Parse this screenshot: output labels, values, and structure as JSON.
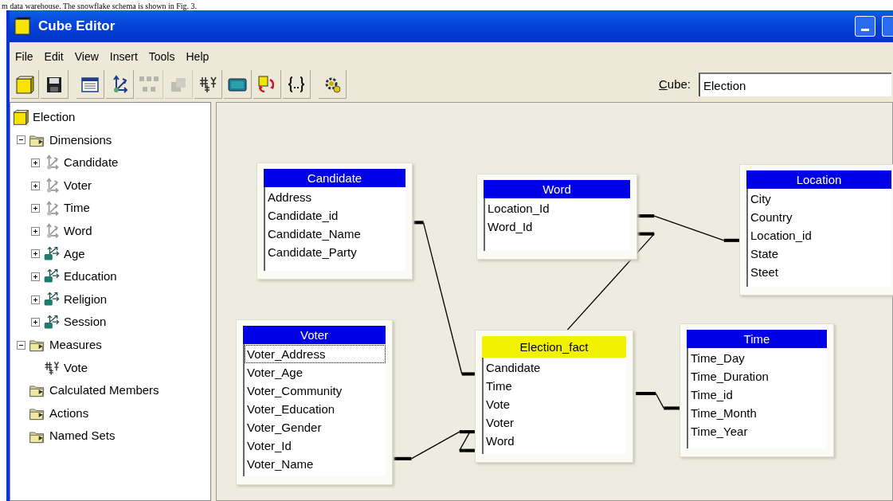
{
  "caption": "m data warehouse. The snowflake schema is shown in Fig. 3.",
  "window": {
    "title": "Cube Editor"
  },
  "menu": [
    "File",
    "Edit",
    "View",
    "Insert",
    "Tools",
    "Help"
  ],
  "toolbar_groups": [
    [
      {
        "kind": "cube",
        "disabled": false
      },
      {
        "kind": "save",
        "disabled": false
      }
    ],
    [
      {
        "kind": "table",
        "disabled": false
      },
      {
        "kind": "dimension",
        "disabled": false
      },
      {
        "kind": "dots",
        "disabled": true
      },
      {
        "kind": "block",
        "disabled": true
      },
      {
        "kind": "measure",
        "disabled": false
      },
      {
        "kind": "screen",
        "disabled": false
      },
      {
        "kind": "process",
        "disabled": false
      },
      {
        "kind": "braces",
        "disabled": false
      }
    ],
    [
      {
        "kind": "gear",
        "disabled": false
      }
    ]
  ],
  "cube_selector": {
    "label": "Cube:",
    "value": "Election"
  },
  "tree": [
    {
      "label": "Election",
      "kind": "cube",
      "children": [
        {
          "label": "Dimensions",
          "kind": "folder",
          "expanded": true,
          "children": [
            {
              "label": "Candidate",
              "kind": "shared_dimension",
              "expanded": false
            },
            {
              "label": "Voter",
              "kind": "shared_dimension",
              "expanded": false
            },
            {
              "label": "Time",
              "kind": "shared_dimension",
              "expanded": false
            },
            {
              "label": "Word",
              "kind": "shared_dimension",
              "expanded": false
            },
            {
              "label": "Age",
              "kind": "private_dimension",
              "expanded": false
            },
            {
              "label": "Education",
              "kind": "private_dimension",
              "expanded": false
            },
            {
              "label": "Religion",
              "kind": "private_dimension",
              "expanded": false
            },
            {
              "label": "Session",
              "kind": "private_dimension",
              "expanded": false
            }
          ]
        },
        {
          "label": "Measures",
          "kind": "folder",
          "expanded": true,
          "children": [
            {
              "label": "Vote",
              "kind": "measure"
            }
          ]
        },
        {
          "label": "Calculated Members",
          "kind": "folder"
        },
        {
          "label": "Actions",
          "kind": "folder"
        },
        {
          "label": "Named Sets",
          "kind": "folder"
        }
      ]
    }
  ],
  "tables": [
    {
      "name": "Candidate",
      "kind": "dimension",
      "fields": [
        {
          "label": "Address",
          "selected": false
        },
        {
          "label": "Candidate_id",
          "selected": false
        },
        {
          "label": "Candidate_Name",
          "selected": false
        },
        {
          "label": "Candidate_Party",
          "selected": false
        }
      ]
    },
    {
      "name": "Word",
      "kind": "dimension",
      "fields": [
        {
          "label": "Location_Id",
          "selected": false
        },
        {
          "label": "Word_Id",
          "selected": false
        }
      ]
    },
    {
      "name": "Location",
      "kind": "dimension",
      "fields": [
        {
          "label": "City",
          "selected": false
        },
        {
          "label": "Country",
          "selected": false
        },
        {
          "label": "Location_id",
          "selected": false
        },
        {
          "label": "State",
          "selected": false
        },
        {
          "label": "Steet",
          "selected": false
        }
      ]
    },
    {
      "name": "Voter",
      "kind": "dimension",
      "fields": [
        {
          "label": "Voter_Address",
          "selected": true
        },
        {
          "label": "Voter_Age",
          "selected": false
        },
        {
          "label": "Voter_Community",
          "selected": false
        },
        {
          "label": "Voter_Education",
          "selected": false
        },
        {
          "label": "Voter_Gender",
          "selected": false
        },
        {
          "label": "Voter_Id",
          "selected": false
        },
        {
          "label": "Voter_Name",
          "selected": false
        }
      ]
    },
    {
      "name": "Election_fact",
      "kind": "fact",
      "fields": [
        {
          "label": "Candidate",
          "selected": false
        },
        {
          "label": "Time",
          "selected": false
        },
        {
          "label": "Vote",
          "selected": false
        },
        {
          "label": "Voter",
          "selected": false
        },
        {
          "label": "Word",
          "selected": false
        }
      ]
    },
    {
      "name": "Time",
      "kind": "dimension",
      "fields": [
        {
          "label": "Time_Day",
          "selected": false
        },
        {
          "label": "Time_Duration",
          "selected": false
        },
        {
          "label": "Time_id",
          "selected": false
        },
        {
          "label": "Time_Month",
          "selected": false
        },
        {
          "label": "Time_Year",
          "selected": false
        }
      ]
    }
  ]
}
